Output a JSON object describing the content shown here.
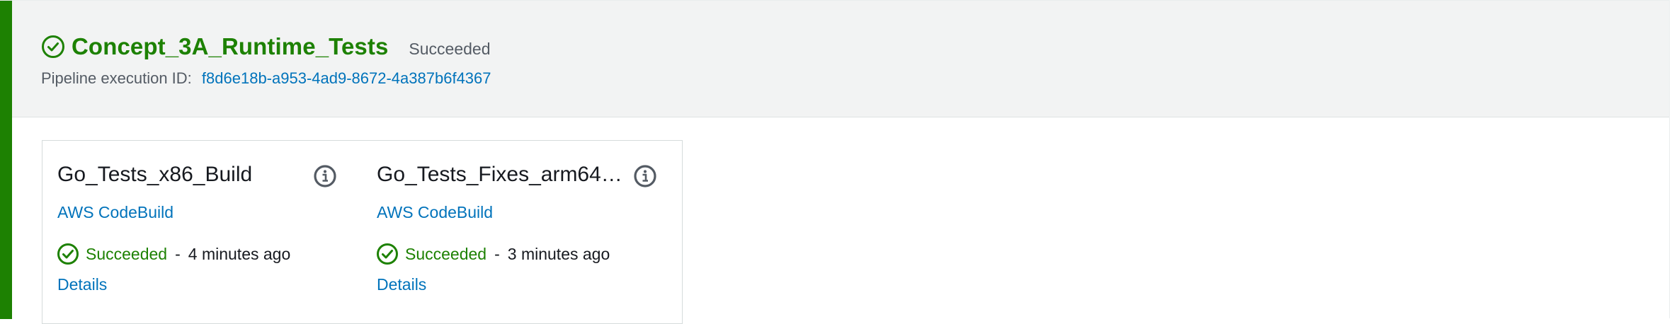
{
  "stage": {
    "title": "Concept_3A_Runtime_Tests",
    "status": "Succeeded",
    "execution_label": "Pipeline execution ID:",
    "execution_id": "f8d6e18b-a953-4ad9-8672-4a387b6f4367",
    "status_color": "#1d8102",
    "link_color": "#0073bb",
    "icon": "check-circle-icon"
  },
  "actions": [
    {
      "name": "Go_Tests_x86_Build",
      "provider": "AWS CodeBuild",
      "status": "Succeeded",
      "separator": "-",
      "time": "4 minutes ago",
      "details": "Details",
      "icon": "check-circle-icon",
      "info_icon": "info-icon"
    },
    {
      "name": "Go_Tests_Fixes_arm64…",
      "provider": "AWS CodeBuild",
      "status": "Succeeded",
      "separator": "-",
      "time": "3 minutes ago",
      "details": "Details",
      "icon": "check-circle-icon",
      "info_icon": "info-icon"
    }
  ]
}
